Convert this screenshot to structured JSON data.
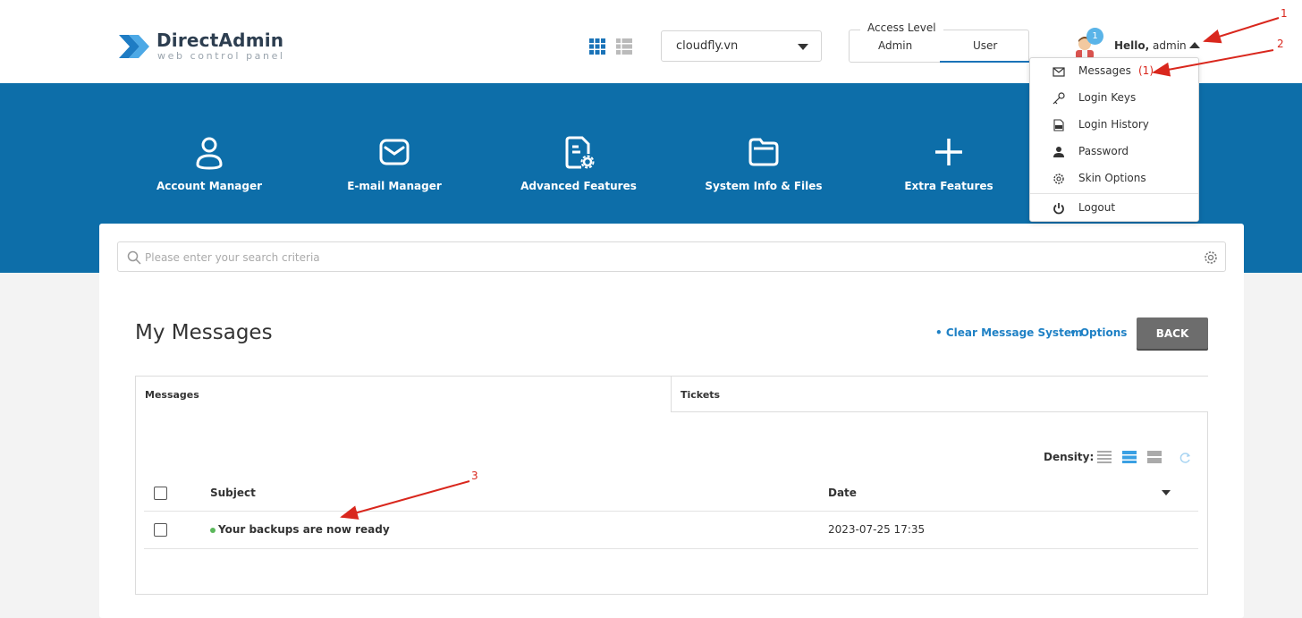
{
  "brand": {
    "name": "DirectAdmin",
    "tagline": "web control panel"
  },
  "header": {
    "domain_select": {
      "selected": "cloudfly.vn"
    },
    "access_level": {
      "title": "Access Level",
      "options": [
        "Admin",
        "User"
      ],
      "active": "User",
      "accent_color": "#1a73b8"
    },
    "user": {
      "badge_count": "1",
      "greeting": "Hello,",
      "username": "admin"
    }
  },
  "user_menu": {
    "items": [
      {
        "label": "Messages",
        "count": "(1)",
        "icon": "envelope-icon"
      },
      {
        "label": "Login Keys",
        "icon": "key-icon"
      },
      {
        "label": "Login History",
        "icon": "log-icon"
      },
      {
        "label": "Password",
        "icon": "user-icon"
      },
      {
        "label": "Skin Options",
        "icon": "gear-icon"
      },
      {
        "label": "Logout",
        "icon": "power-icon"
      }
    ]
  },
  "nav": {
    "background_color": "#0d6ea9",
    "items": [
      {
        "label": "Account Manager",
        "icon": "user-icon"
      },
      {
        "label": "E-mail Manager",
        "icon": "envelope-icon"
      },
      {
        "label": "Advanced Features",
        "icon": "document-gear-icon"
      },
      {
        "label": "System Info & Files",
        "icon": "folder-icon"
      },
      {
        "label": "Extra Features",
        "icon": "plus-icon"
      }
    ]
  },
  "search": {
    "placeholder": "Please enter your search criteria"
  },
  "page": {
    "title": "My Messages",
    "links": [
      "• Clear Message System",
      "• Options"
    ],
    "back_label": "BACK"
  },
  "tabs": [
    "Messages",
    "Tickets"
  ],
  "table": {
    "density_label": "Density:",
    "columns": [
      "Subject",
      "Date"
    ],
    "rows": [
      {
        "subject": "Your backups are now ready",
        "date": "2023-07-25 17:35",
        "status_color": "#5cb85c"
      }
    ]
  },
  "annotations": {
    "labels": [
      "1",
      "2",
      "3"
    ],
    "color": "#d9271d"
  }
}
